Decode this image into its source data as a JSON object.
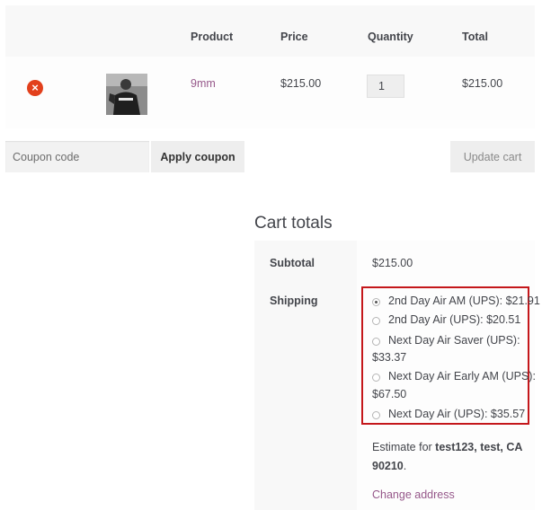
{
  "cart": {
    "headers": {
      "product": "Product",
      "price": "Price",
      "quantity": "Quantity",
      "total": "Total"
    },
    "items": [
      {
        "remove_icon": "remove-icon",
        "thumbnail": "product-thumbnail",
        "name": "9mm",
        "price": "$215.00",
        "quantity": "1",
        "total": "$215.00"
      }
    ]
  },
  "actions": {
    "coupon_placeholder": "Coupon code",
    "apply_coupon_label": "Apply coupon",
    "update_cart_label": "Update cart"
  },
  "cart_totals": {
    "title": "Cart totals",
    "subtotal_label": "Subtotal",
    "subtotal_value": "$215.00",
    "shipping_label": "Shipping",
    "shipping_lines": [
      {
        "text": "2nd Day Air AM (UPS): $21.91",
        "radio": true,
        "checked": true
      },
      {
        "text": "2nd Day Air (UPS): $20.51",
        "radio": true,
        "checked": false
      },
      {
        "text": "Next Day Air Saver (UPS):",
        "radio": true,
        "checked": false
      },
      {
        "text": "$33.37",
        "radio": false
      },
      {
        "text": "Next Day Air Early AM (UPS):",
        "radio": true,
        "checked": false
      },
      {
        "text": "$67.50",
        "radio": false
      },
      {
        "text": "Next Day Air (UPS): $35.57",
        "radio": true,
        "checked": false
      }
    ],
    "estimate_prefix": "Estimate for",
    "estimate_address_line1": "test123, test, CA",
    "estimate_address_line2": "90210",
    "estimate_suffix": ".",
    "change_address_label": "Change address"
  },
  "colors": {
    "accent_link": "#96588a",
    "remove_red": "#e2401c",
    "highlight_border": "#c4171b"
  }
}
